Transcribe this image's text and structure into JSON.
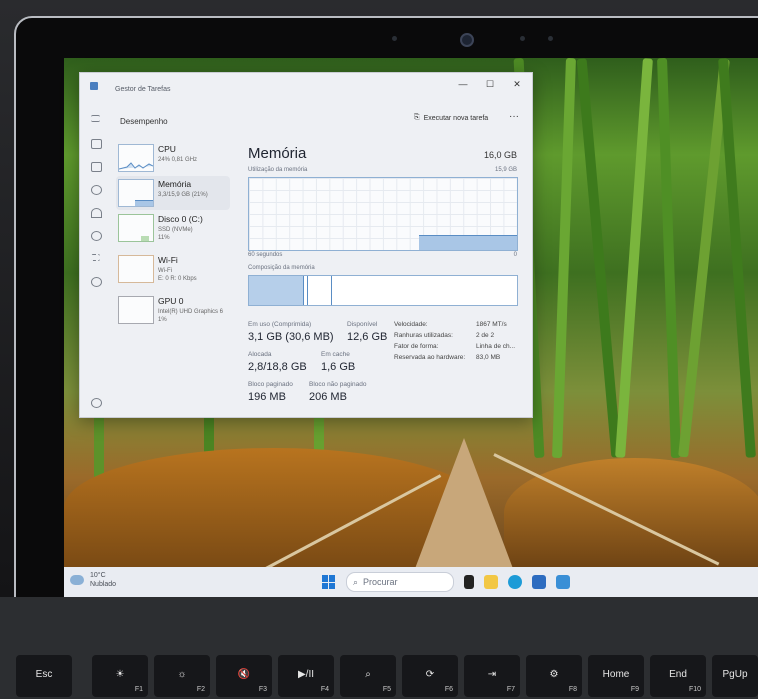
{
  "task_manager": {
    "title": "Gestor de Tarefas",
    "header": "Desempenho",
    "run_new_task": "Executar nova tarefa",
    "sidebar": [
      {
        "name": "CPU",
        "sub": "24% 0,81 GHz"
      },
      {
        "name": "Memória",
        "sub": "3,3/15,9 GB (21%)"
      },
      {
        "name": "Disco 0 (C:)",
        "sub": "SSD (NVMe)",
        "sub2": "11%"
      },
      {
        "name": "Wi-Fi",
        "sub": "Wi-Fi",
        "sub2": "E: 0 R: 0 Kbps"
      },
      {
        "name": "GPU 0",
        "sub": "Intel(R) UHD Graphics 6",
        "sub2": "1%"
      }
    ],
    "memory": {
      "title": "Memória",
      "total": "16,0 GB",
      "usage_label": "Utilização da memória",
      "usage_max": "15,9 GB",
      "time_left": "60 segundos",
      "time_right": "0",
      "composition_label": "Composição da memória",
      "usage_level_fraction": 0.21,
      "stats": {
        "in_use_label": "Em uso (Comprimida)",
        "in_use_value": "3,1 GB (30,6 MB)",
        "available_label": "Disponível",
        "available_value": "12,6 GB",
        "committed_label": "Alocada",
        "committed_value": "2,8/18,8 GB",
        "cached_label": "Em cache",
        "cached_value": "1,6 GB",
        "paged_label": "Bloco paginado",
        "paged_value": "196 MB",
        "nonpaged_label": "Bloco não paginado",
        "nonpaged_value": "206 MB"
      },
      "details": [
        {
          "k": "Velocidade:",
          "v": "1867 MT/s"
        },
        {
          "k": "Ranhuras utilizadas:",
          "v": "2 de 2"
        },
        {
          "k": "Fator de forma:",
          "v": "Linha de ch..."
        },
        {
          "k": "Reservada ao hardware:",
          "v": "83,0 MB"
        }
      ]
    }
  },
  "taskbar": {
    "temp": "10°C",
    "weather": "Nublado",
    "search_placeholder": "Procurar"
  },
  "keyboard": [
    {
      "label": "Esc",
      "fn": ""
    },
    {
      "label": "☀",
      "fn": "F1"
    },
    {
      "label": "☼",
      "fn": "F2"
    },
    {
      "label": "🔇",
      "fn": "F3"
    },
    {
      "label": "▶/II",
      "fn": "F4"
    },
    {
      "label": "⌕",
      "fn": "F5"
    },
    {
      "label": "⟳",
      "fn": "F6"
    },
    {
      "label": "⇥",
      "fn": "F7"
    },
    {
      "label": "⚙",
      "fn": "F8"
    },
    {
      "label": "Home",
      "fn": "F9"
    },
    {
      "label": "End",
      "fn": "F10"
    },
    {
      "label": "PgUp",
      "fn": ""
    }
  ],
  "colors": {
    "accent": "#1f77d4",
    "graph_fill": "#a9c6e6",
    "graph_border": "#5a8dc4"
  }
}
